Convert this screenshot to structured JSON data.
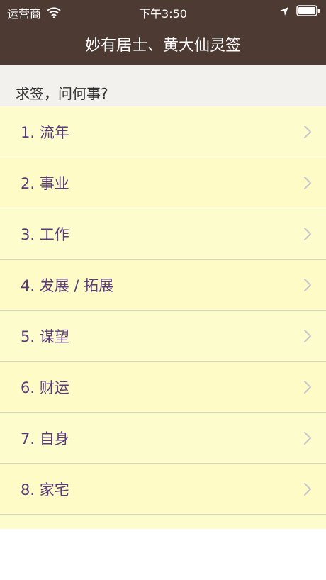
{
  "status_bar": {
    "carrier": "运营商",
    "time": "下午3:50",
    "wifi_icon": "wifi-icon",
    "location_icon": "location-arrow-icon",
    "battery_icon": "battery-icon"
  },
  "nav": {
    "title": "妙有居士、黄大仙灵签"
  },
  "section": {
    "title": "求签，问何事?"
  },
  "list": {
    "items": [
      {
        "label": "1. 流年"
      },
      {
        "label": "2. 事业"
      },
      {
        "label": "3. 工作"
      },
      {
        "label": "4. 发展 / 拓展"
      },
      {
        "label": "5. 谋望"
      },
      {
        "label": "6. 财运"
      },
      {
        "label": "7. 自身"
      },
      {
        "label": "8. 家宅"
      }
    ]
  },
  "colors": {
    "nav_background": "#4d3a33",
    "row_background": "#fdfccc",
    "label_text": "#5a3a7c"
  }
}
